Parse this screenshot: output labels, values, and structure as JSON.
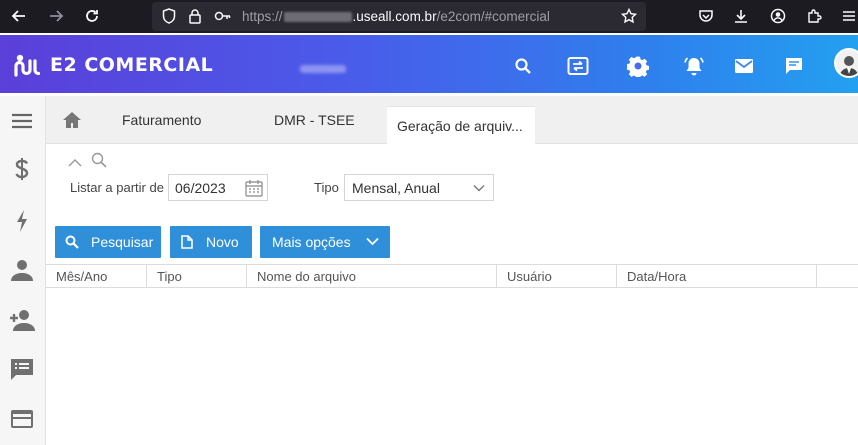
{
  "browser": {
    "url_prefix": "https://",
    "url_domain": ".useall.com.br",
    "url_path": "/e2com/#comercial"
  },
  "app": {
    "name": "E2 COMERCIAL"
  },
  "tabs": [
    {
      "label": "Faturamento"
    },
    {
      "label": "DMR - TSEE"
    },
    {
      "label": "Geração de arquiv..."
    }
  ],
  "filters": {
    "start_label": "Listar a partir de",
    "start_value": "06/2023",
    "type_label": "Tipo",
    "type_value": "Mensal, Anual"
  },
  "actions": {
    "search_label": "Pesquisar",
    "new_label": "Novo",
    "more_label": "Mais opções"
  },
  "grid": {
    "columns": [
      "Mês/Ano",
      "Tipo",
      "Nome do arquivo",
      "Usuário",
      "Data/Hora"
    ]
  },
  "colors": {
    "header_gradient_start": "#5b3fd9",
    "header_gradient_end": "#23a0f0",
    "button_blue": "#2f8fd8"
  }
}
